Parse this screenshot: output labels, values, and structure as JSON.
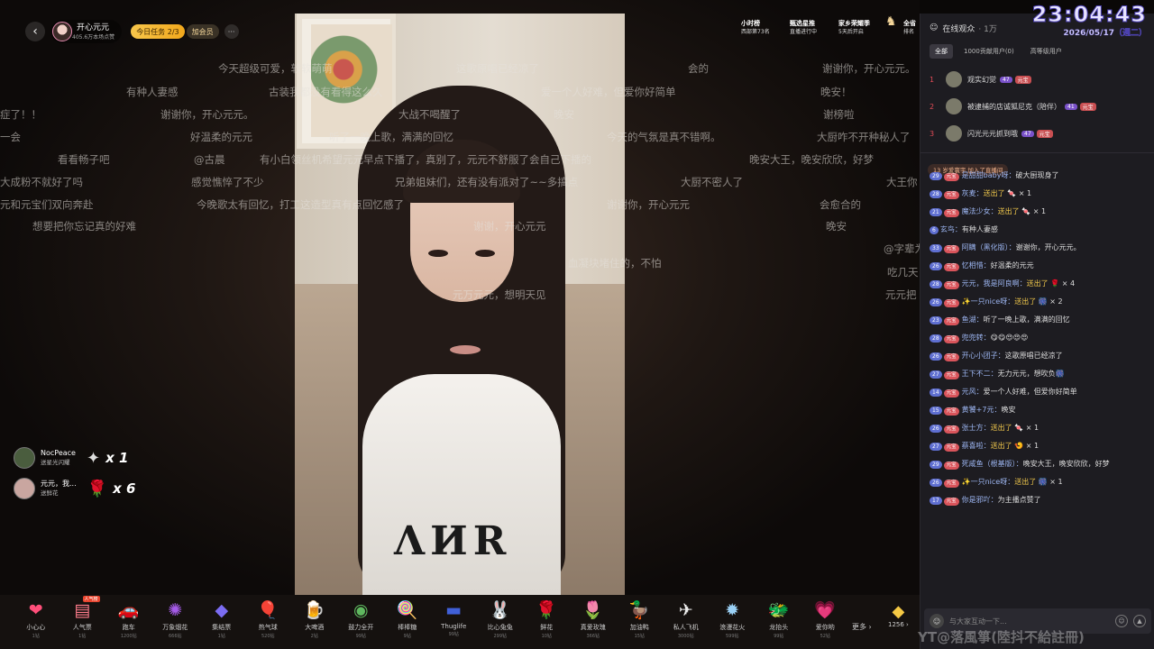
{
  "host": {
    "name": "开心元元",
    "sub": "405.6万本场点赞",
    "task": "今日任务 2/3",
    "vip": "加会员",
    "more": "···"
  },
  "ranks": [
    {
      "title": "小时榜",
      "sub": "西部第73名"
    },
    {
      "title": "甄选星推",
      "sub": "直播进行中"
    },
    {
      "title": "家乡荣耀季",
      "sub": "5天后开启"
    },
    {
      "title": "全省",
      "sub": "排名"
    }
  ],
  "danmu": [
    "今天超级可爱，软软萌萌",
    "这歌原唱已经凉了",
    "会的",
    "谢谢你，开心元元。",
    "有种人妻感",
    "古装我都没有看得这么久",
    "爱一个人好难，但爱你好简单",
    "晚安！",
    "症了！！",
    "谢谢你，开心元元。",
    "大战不喝醒了",
    "晚安",
    "谢榜啦",
    "一会",
    "好温柔的元元",
    "听了一晚上歌，满满的回忆",
    "今天的气氛是真不错啊。",
    "大厨咋不开种秘人了",
    "看看畅子吧",
    "@古晨",
    "有小白领丝机希望元元早点下播了，真别了，元元不舒服了会自己下播的",
    "晚安大王，晚安欣欣，好梦",
    "大成粉不就好了吗",
    "感觉憔悴了不少",
    "兄弟姐妹们，还有没有派对了~~多搞点",
    "大厨不密人了",
    "大王你",
    "元和元宝们双向奔赴",
    "今晚歌太有回忆，打工这造型真有点回忆感了",
    "谢谢你，开心元元",
    "会愈合的",
    "想要把你忘记真的好难",
    "谢谢，开心元元",
    "晚安",
    "@字辈为",
    "吃几天",
    "元元把",
    "血凝块堵住的，不怕",
    "元万元元，想明天见"
  ],
  "gift_toasts": [
    {
      "name": "NocPeace",
      "sub": "送星光闪耀",
      "icon": "✦",
      "count": "x 1"
    },
    {
      "name": "元元，我...",
      "sub": "送鲜花",
      "icon": "🌹",
      "count": "x 6"
    }
  ],
  "gifts": [
    {
      "label": "小心心",
      "price": "1钻",
      "icon": "❤",
      "color": "#ff4f7a"
    },
    {
      "label": "人气票",
      "price": "1钻",
      "icon": "▤",
      "color": "#ff7d8d",
      "hot": "人气榜"
    },
    {
      "label": "跑车",
      "price": "1200钻",
      "icon": "🚗",
      "color": "#e23b3b"
    },
    {
      "label": "万象烟花",
      "price": "666钻",
      "icon": "✺",
      "color": "#a55be8"
    },
    {
      "label": "集结票",
      "price": "1钻",
      "icon": "◆",
      "color": "#7b6cf2"
    },
    {
      "label": "热气球",
      "price": "520钻",
      "icon": "🎈",
      "color": "#f0a4c9"
    },
    {
      "label": "大啤酒",
      "price": "2钻",
      "icon": "🍺",
      "color": "#f5c944"
    },
    {
      "label": "鼓力全开",
      "price": "99钻",
      "icon": "◉",
      "color": "#5fb85f"
    },
    {
      "label": "棒棒糖",
      "price": "9钻",
      "icon": "🍭",
      "color": "#ff6fa8"
    },
    {
      "label": "Thuglife",
      "price": "99钻",
      "icon": "▬",
      "color": "#4060d8"
    },
    {
      "label": "比心兔兔",
      "price": "299钻",
      "icon": "🐰",
      "color": "#dfe3f7"
    },
    {
      "label": "鲜花",
      "price": "10钻",
      "icon": "🌹",
      "color": "#e23b3b"
    },
    {
      "label": "真爱玫瑰",
      "price": "366钻",
      "icon": "🌷",
      "color": "#f08aa0"
    },
    {
      "label": "加油鸭",
      "price": "15钻",
      "icon": "🦆",
      "color": "#f5c944"
    },
    {
      "label": "私人飞机",
      "price": "3000钻",
      "icon": "✈",
      "color": "#eee"
    },
    {
      "label": "浪漫花火",
      "price": "599钻",
      "icon": "✹",
      "color": "#9ad0f5"
    },
    {
      "label": "龙抬头",
      "price": "99钻",
      "icon": "🐲",
      "color": "#9fd08a"
    },
    {
      "label": "爱你哟",
      "price": "52钻",
      "icon": "💗",
      "color": "#ff8fb0"
    }
  ],
  "gift_more": "更多 ›",
  "coin": {
    "icon": "◆",
    "value": "1256 ›"
  },
  "audience": {
    "title": "在线观众",
    "count": "· 1万",
    "tabs": [
      "全部",
      "1000贡献用户(0)",
      "高等级用户"
    ]
  },
  "top3": [
    {
      "rank": "1",
      "name": "观实幻觉",
      "badge": "47",
      "fan": "元宝"
    },
    {
      "rank": "2",
      "name": "被逮捕的店诚狐尼克（陪伴）",
      "badge": "41",
      "fan": "元宝"
    },
    {
      "rank": "3",
      "name": "闪光元元抓到哦",
      "badge": "47",
      "fan": "元宝"
    }
  ],
  "join": "13  岁爱寰宇  加入了直播间",
  "chat": [
    {
      "lv": "29",
      "fan": "元宝",
      "name": "是甜甜baby呀：",
      "text": "破大厨现身了"
    },
    {
      "lv": "28",
      "fan": "元宝",
      "name": "灰麦：",
      "gift": "送出了 🍬",
      "count": "× 1"
    },
    {
      "lv": "21",
      "fan": "元宝",
      "name": "魔法少女：",
      "gift": "送出了 🍬",
      "count": "× 1"
    },
    {
      "lv": "6",
      "fan": "",
      "name": "玄鸟：",
      "text": "有种人妻感"
    },
    {
      "lv": "33",
      "fan": "元宝",
      "name": "阿瞒（黑化版）：",
      "text": "谢谢你，开心元元。"
    },
    {
      "lv": "26",
      "fan": "元宝",
      "name": "忆相惜：",
      "text": "好温柔的元元"
    },
    {
      "lv": "28",
      "fan": "元宝",
      "name": "元元，我是阿良啊：",
      "gift": "送出了 🌹",
      "count": "× 4"
    },
    {
      "lv": "26",
      "fan": "元宝",
      "name": "✨一只nice呀：",
      "gift": "送出了 🎆",
      "count": "× 2"
    },
    {
      "lv": "23",
      "fan": "元宝",
      "name": "鱼湖：",
      "text": "听了一晚上歌，满满的回忆"
    },
    {
      "lv": "28",
      "fan": "元宝",
      "name": "兜兜转：",
      "text": "😋😋😍😍😍"
    },
    {
      "lv": "26",
      "fan": "元宝",
      "name": "开心小团子：",
      "text": "这歌原唱已经凉了"
    },
    {
      "lv": "27",
      "fan": "元宝",
      "name": "王下不二：",
      "text": "无力元元，想吹负🎆"
    },
    {
      "lv": "14",
      "fan": "元宝",
      "name": "元风：",
      "text": "爱一个人好难，但爱你好简单"
    },
    {
      "lv": "15",
      "fan": "元宝",
      "name": "黄饕+7元：",
      "text": "晚安"
    },
    {
      "lv": "26",
      "fan": "元宝",
      "name": "张士方：",
      "gift": "送出了 🍬",
      "count": "× 1"
    },
    {
      "lv": "27",
      "fan": "元宝",
      "name": "蔡喜啦：",
      "gift": "送出了 🍤",
      "count": "× 1"
    },
    {
      "lv": "29",
      "fan": "元宝",
      "name": "死咸鱼（根基版）：",
      "text": "晚安大王，晚安欣欣，好梦"
    },
    {
      "lv": "26",
      "fan": "元宝",
      "name": "✨一只nice呀：",
      "gift": "送出了 🎆",
      "count": "× 1"
    },
    {
      "lv": "17",
      "fan": "元宝",
      "name": "你是邪吖：",
      "text": "为主播点赞了"
    }
  ],
  "input": {
    "emoji": "☺",
    "placeholder": "与大家互动一下..."
  },
  "clock": {
    "time": "23:04:43",
    "date": "2026/05/17（週二）"
  },
  "watermark": "YT@落風箏(陸抖不給註冊)"
}
